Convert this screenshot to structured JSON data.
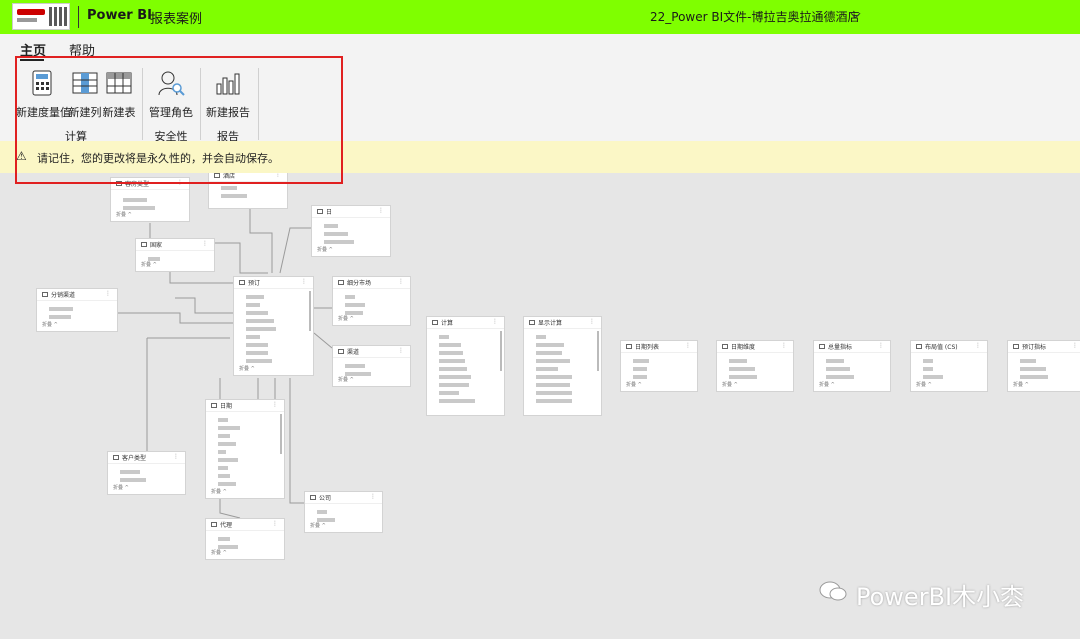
{
  "header": {
    "app_name": "Power BI",
    "report_name": "报表案例",
    "file_name": "22_Power BI文件-博拉吉奥拉通德酒店"
  },
  "tabs": [
    {
      "label": "主页",
      "active": true
    },
    {
      "label": "帮助",
      "active": false
    }
  ],
  "ribbon": {
    "new_measure": "新建度量值",
    "new_column": "新建列",
    "new_table": "新建表",
    "manage_roles": "管理角色",
    "new_report": "新建报告",
    "group_calc": "计算",
    "group_security": "安全性",
    "group_report": "报告"
  },
  "notice": {
    "message": "请记住，您的更改将是永久性的，并会自动保存。"
  },
  "watermark": {
    "text": "PowerBI木小枩"
  },
  "colors": {
    "topbar": "#7fff00",
    "highlight": "#e02020",
    "notice_bg": "#fbf7c6"
  }
}
